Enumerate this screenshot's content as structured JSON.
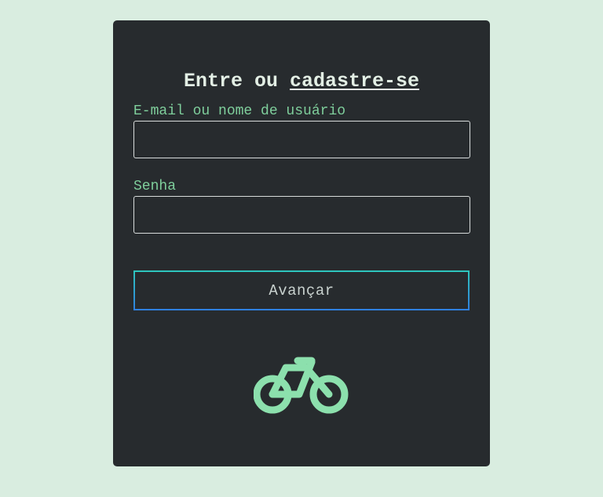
{
  "login": {
    "title_prefix": "Entre ou ",
    "title_link": "cadastre-se",
    "username_label": "E-mail ou nome de usuário",
    "username_value": "",
    "password_label": "Senha",
    "password_value": "",
    "submit_label": "Avançar",
    "logo_icon": "bicycle-icon"
  },
  "colors": {
    "page_background": "#d9ede0",
    "card_background": "#272b2e",
    "title_text": "#e3efe5",
    "label_text": "#7fcf9c",
    "logo": "#8ce0ad",
    "button_border_top": "#2ec7bd",
    "button_border_bottom": "#2f7fe0"
  }
}
